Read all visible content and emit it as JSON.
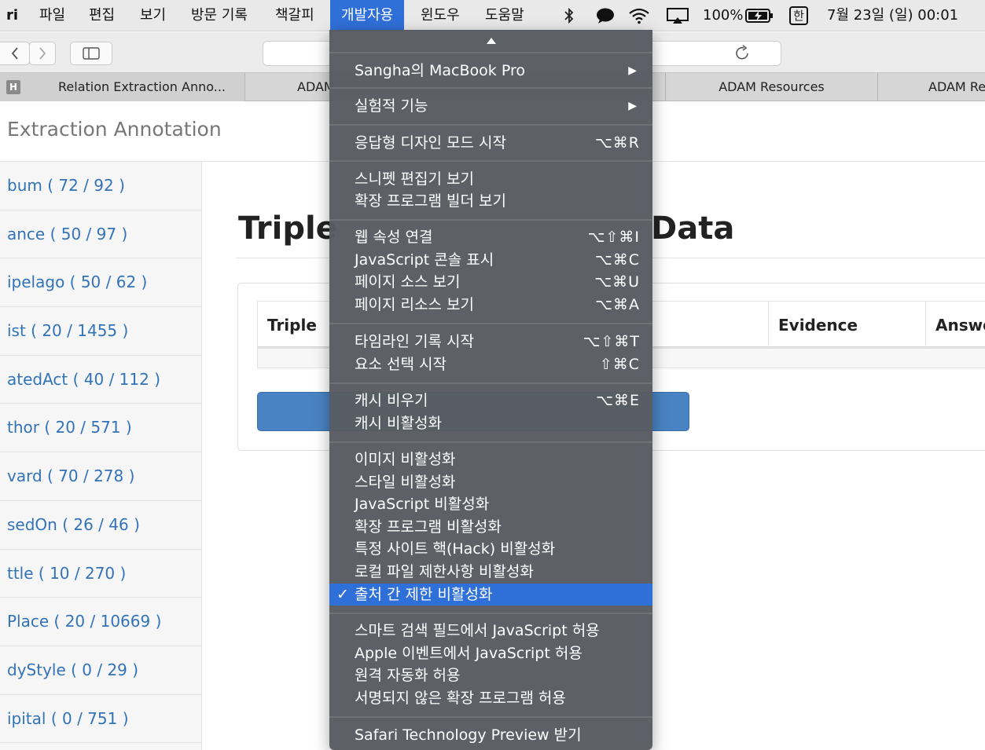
{
  "menubar": {
    "app": "ri",
    "items": [
      "파일",
      "편집",
      "보기",
      "방문 기록",
      "책갈피",
      "개발자용",
      "윈도우",
      "도움말"
    ],
    "active_index": 5,
    "battery": "100%",
    "ime": "한",
    "datetime": "7월 23일 (일) 00:01"
  },
  "tabs": [
    {
      "label": "Relation Extraction Anno..."
    },
    {
      "label": "ADAM"
    },
    {
      "label": "ADAM Resources"
    },
    {
      "label": "ADAM Re"
    }
  ],
  "page": {
    "brand": "Extraction Annotation",
    "title_left": "Triple",
    "title_right": "Data",
    "table_headers": [
      "Triple",
      "Evidence",
      "Answe"
    ],
    "sidebar": [
      "bum ( 72 / 92 )",
      "ance ( 50 / 97 )",
      "ipelago ( 50 / 62 )",
      "ist ( 20 / 1455 )",
      "atedAct ( 40 / 112 )",
      "thor ( 20 / 571 )",
      "vard ( 70 / 278 )",
      "sedOn ( 26 / 46 )",
      "ttle ( 10 / 270 )",
      "Place ( 20 / 10669 )",
      "dyStyle ( 0 / 29 )",
      "ipital ( 0 / 751 )"
    ]
  },
  "devmenu": {
    "items": [
      {
        "label": "Sangha의 MacBook Pro",
        "shortcut": "",
        "submenu": true
      },
      {
        "label": "실험적 기능",
        "shortcut": "",
        "submenu": true
      },
      {
        "label": "응답형 디자인 모드 시작",
        "shortcut": "⌥⌘R"
      },
      {
        "label": "스니펫 편집기 보기",
        "shortcut": ""
      },
      {
        "label": "확장 프로그램 빌더 보기",
        "shortcut": ""
      },
      {
        "label": "웹 속성 연결",
        "shortcut": "⌥⇧⌘I"
      },
      {
        "label": "JavaScript 콘솔 표시",
        "shortcut": "⌥⌘C"
      },
      {
        "label": "페이지 소스 보기",
        "shortcut": "⌥⌘U"
      },
      {
        "label": "페이지 리소스 보기",
        "shortcut": "⌥⌘A"
      },
      {
        "label": "타임라인 기록 시작",
        "shortcut": "⌥⇧⌘T"
      },
      {
        "label": "요소 선택 시작",
        "shortcut": "⇧⌘C"
      },
      {
        "label": "캐시 비우기",
        "shortcut": "⌥⌘E"
      },
      {
        "label": "캐시 비활성화",
        "shortcut": ""
      },
      {
        "label": "이미지 비활성화",
        "shortcut": ""
      },
      {
        "label": "스타일 비활성화",
        "shortcut": ""
      },
      {
        "label": "JavaScript 비활성화",
        "shortcut": ""
      },
      {
        "label": "확장 프로그램 비활성화",
        "shortcut": ""
      },
      {
        "label": "특정 사이트 핵(Hack) 비활성화",
        "shortcut": ""
      },
      {
        "label": "로컬 파일 제한사항 비활성화",
        "shortcut": ""
      },
      {
        "label": "출처 간 제한 비활성화",
        "shortcut": "",
        "checked": true
      },
      {
        "label": "스마트 검색 필드에서 JavaScript 허용",
        "shortcut": ""
      },
      {
        "label": "Apple 이벤트에서 JavaScript 허용",
        "shortcut": ""
      },
      {
        "label": "원격 자동화 허용",
        "shortcut": ""
      },
      {
        "label": "서명되지 않은 확장 프로그램 허용",
        "shortcut": ""
      },
      {
        "label": "Safari Technology Preview 받기",
        "shortcut": ""
      }
    ]
  },
  "colors": {
    "accent": "#2f6fd8",
    "link": "#3273b8",
    "menu_bg": "#585c62"
  }
}
